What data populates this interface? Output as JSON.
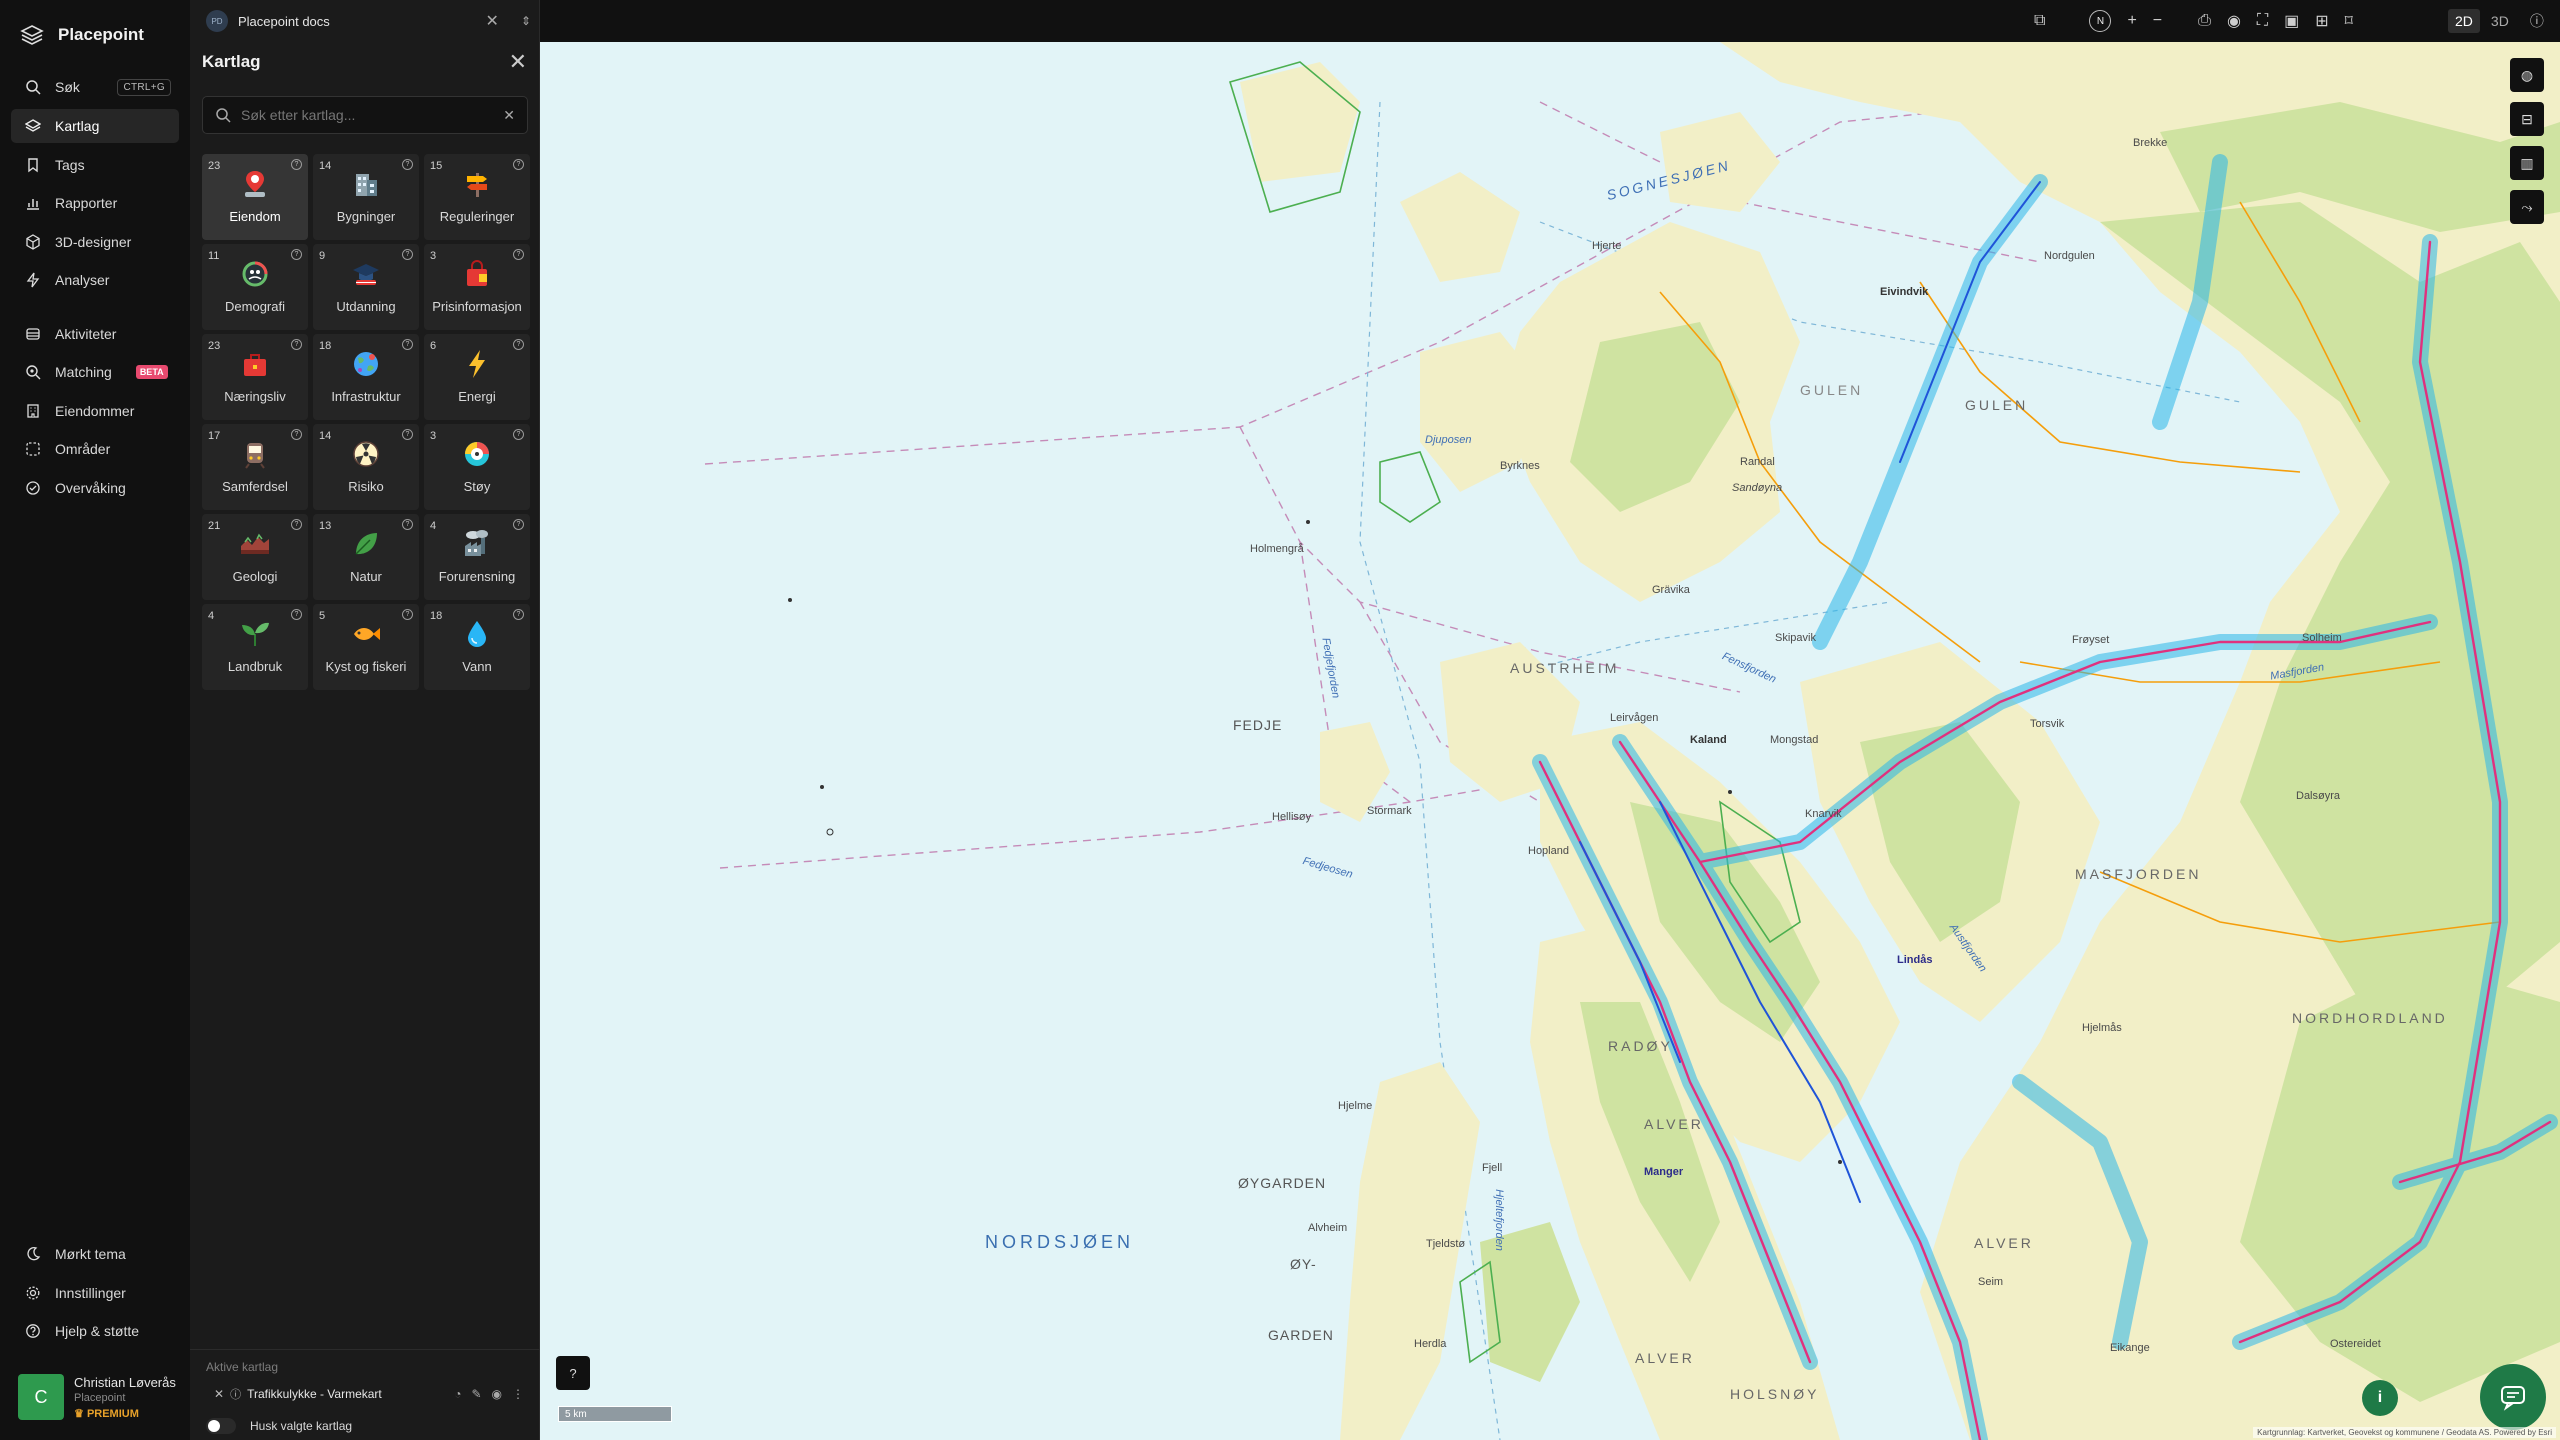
{
  "nav": {
    "brand": "Placepoint",
    "items": [
      {
        "label": "Søk",
        "shortcut": "CTRL+G",
        "icon": "search-icon"
      },
      {
        "label": "Kartlag",
        "icon": "layers-icon"
      },
      {
        "label": "Tags",
        "icon": "bookmark-icon"
      },
      {
        "label": "Rapporter",
        "icon": "bar-chart-icon"
      },
      {
        "label": "3D-designer",
        "icon": "cube-icon"
      },
      {
        "label": "Analyser",
        "icon": "lightning-icon"
      },
      {
        "label": "Aktiviteter",
        "icon": "stack-icon"
      },
      {
        "label": "Matching",
        "badge": "BETA",
        "icon": "search-match-icon"
      },
      {
        "label": "Eiendommer",
        "icon": "building-icon"
      },
      {
        "label": "Områder",
        "icon": "dashed-square-icon"
      },
      {
        "label": "Overvåking",
        "icon": "check-circle-icon"
      }
    ],
    "bottom": [
      {
        "label": "Mørkt tema",
        "icon": "moon-icon"
      },
      {
        "label": "Innstillinger",
        "icon": "gear-icon"
      },
      {
        "label": "Hjelp & støtte",
        "icon": "help-icon"
      }
    ],
    "user": {
      "initial": "C",
      "name": "Christian Løverås",
      "org": "Placepoint",
      "plan": "PREMIUM"
    }
  },
  "panel": {
    "workspace": {
      "badge": "PD",
      "name": "Placepoint docs"
    },
    "title": "Kartlag",
    "search_placeholder": "Søk etter kartlag...",
    "tiles": [
      {
        "count": "23",
        "label": "Eiendom",
        "icon": "property-pin-icon"
      },
      {
        "count": "14",
        "label": "Bygninger",
        "icon": "buildings-icon"
      },
      {
        "count": "15",
        "label": "Reguleringer",
        "icon": "signpost-icon"
      },
      {
        "count": "11",
        "label": "Demografi",
        "icon": "demography-icon"
      },
      {
        "count": "9",
        "label": "Utdanning",
        "icon": "graduation-cap-icon"
      },
      {
        "count": "3",
        "label": "Prisinformasjon",
        "icon": "shopping-bag-icon"
      },
      {
        "count": "23",
        "label": "Næringsliv",
        "icon": "briefcase-icon"
      },
      {
        "count": "18",
        "label": "Infrastruktur",
        "icon": "globe-icon"
      },
      {
        "count": "6",
        "label": "Energi",
        "icon": "lightning-bolt-icon"
      },
      {
        "count": "17",
        "label": "Samferdsel",
        "icon": "train-icon"
      },
      {
        "count": "14",
        "label": "Risiko",
        "icon": "radiation-icon"
      },
      {
        "count": "3",
        "label": "Støy",
        "icon": "noise-gauge-icon"
      },
      {
        "count": "21",
        "label": "Geologi",
        "icon": "terrain-icon"
      },
      {
        "count": "13",
        "label": "Natur",
        "icon": "leaf-icon"
      },
      {
        "count": "4",
        "label": "Forurensning",
        "icon": "factory-icon"
      },
      {
        "count": "4",
        "label": "Landbruk",
        "icon": "plant-icon"
      },
      {
        "count": "5",
        "label": "Kyst og fiskeri",
        "icon": "fish-icon"
      },
      {
        "count": "18",
        "label": "Vann",
        "icon": "water-drop-icon"
      }
    ],
    "active_title": "Aktive kartlag",
    "active_layers": [
      {
        "name": "Trafikkulykke - Varmekart"
      }
    ],
    "remember_label": "Husk valgte kartlag"
  },
  "topbar": {
    "compass": "N",
    "mode_2d": "2D",
    "mode_3d": "3D"
  },
  "map": {
    "scale_label": "5 km",
    "attribution": "Kartgrunnlag: Kartverket, Geovekst og kommunene / Geodata AS. Powered by Esri",
    "labels": {
      "nordsjoen": "NORDSJØEN",
      "sognesjoen": "SOGNESJØEN",
      "nordhordland": "NORDHORDLAND",
      "gulen": "GULEN",
      "gulen2": "GULEN",
      "austrheim": "AUSTRHEIM",
      "fedje": "FEDJE",
      "radoy": "RADØY",
      "alver": "ALVER",
      "alver2": "ALVER",
      "alver3": "ALVER",
      "masfjorden": "MASFJORDEN",
      "oygarden": "ØYGARDEN",
      "oy": "ØY-",
      "garden": "GARDEN",
      "holsnoy": "HOLSNØY",
      "holmengra": "Holmengrå",
      "hellisoy": "Hellisøy",
      "stormark": "Stormark",
      "fedjeosen": "Fedjeosen",
      "fedjefjorden": "Fedjefjorden",
      "djuposen": "Djuposen",
      "byrknes": "Byrknes",
      "sandoyna": "Sandøyna",
      "randal": "Randal",
      "gravika": "Grävika",
      "skipavik": "Skipavik",
      "fensfjorden": "Fensfjorden",
      "leirvagen": "Leirvågen",
      "kaland": "Kaland",
      "mongstad": "Mongstad",
      "knarvik": "Knarvik",
      "hopland": "Hopland",
      "lindas": "Lindås",
      "hjeltefjorden": "Hjeltefjorden",
      "austfjorden": "Austfjorden",
      "masfjorden_fjord": "Masfjorden",
      "frovset": "Frøyset",
      "eivindvik": "Eivindvik",
      "brekke": "Brekke",
      "hjelme": "Hjelme",
      "alvheim": "Alvheim",
      "fjell": "Fjell",
      "herdla": "Herdla",
      "tjeldstø": "Tjeldstø",
      "manger": "Manger",
      "seim": "Seim",
      "eikange": "Eikange",
      "ostereidet": "Ostereidet",
      "hjerte": "Hjerte",
      "nordgulen": "Nordgulen",
      "hjelmas": "Hjelmås",
      "solheim": "Solheim",
      "dalsoyra": "Dalsøyra",
      "torsvik": "Torsvik"
    }
  },
  "colors": {
    "accent_green": "#1f7a47",
    "active_route": "#e0317e",
    "heat_blue": "#2bb7ea",
    "land": "#f2efc7",
    "forest": "#cfe3a1",
    "sea": "#e2f4f7"
  }
}
